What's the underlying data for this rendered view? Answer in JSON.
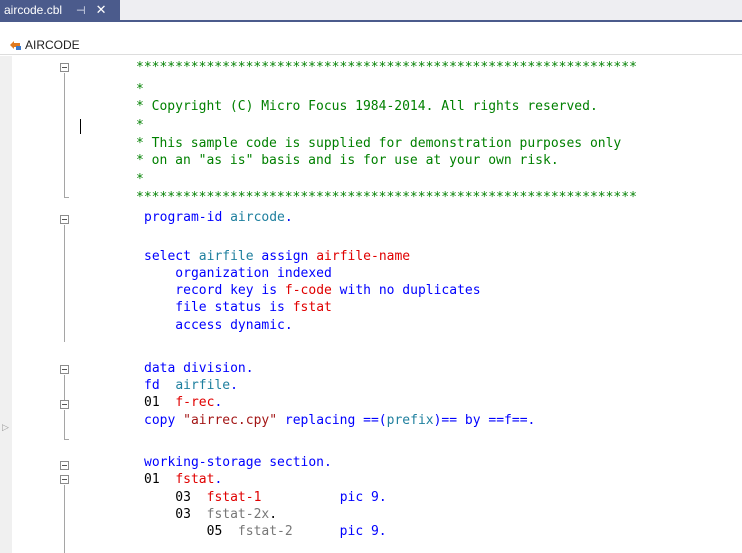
{
  "tab": {
    "title": "aircode.cbl",
    "pin_glyph": "⊣",
    "close_glyph": "✕"
  },
  "nav": {
    "program": "AIRCODE"
  },
  "colors": {
    "tab_active": "#4b5b8c",
    "comment": "#008000",
    "keyword": "#0000ff",
    "identifier": "#1e7f9e",
    "variable": "#e00000",
    "literal": "#a31515"
  },
  "code": {
    "line1": "****************************************************************",
    "line2": "*",
    "line3": "* Copyright (C) Micro Focus 1984-2014. All rights reserved.",
    "line4": "*",
    "line5": "* This sample code is supplied for demonstration purposes only",
    "line6": "* on an \"as is\" basis and is for use at your own risk.",
    "line7": "*",
    "line8": "****************************************************************",
    "prog_kw": "program-id ",
    "prog_name": "aircode",
    "prog_dot": ".",
    "sel_kw1": "select ",
    "sel_file": "airfile",
    "sel_kw2": " assign ",
    "sel_var": "airfile-name",
    "org": "    organization indexed",
    "rk_kw1": "    record key is ",
    "rk_var": "f-code",
    "rk_kw2": " with no duplicates",
    "fs_kw": "    file status is ",
    "fs_var": "fstat",
    "access": "    access dynamic.",
    "data_div": "data division.",
    "fd_kw": "fd  ",
    "fd_name": "airfile",
    "fd_dot": ".",
    "rec_lvl": "01  ",
    "rec_var": "f-rec",
    "rec_dot": ".",
    "copy_kw": "copy ",
    "copy_lit": "\"airrec.cpy\"",
    "copy_kw2": " replacing ==(",
    "copy_id": "prefix",
    "copy_kw3": ")== by ==f==.",
    "ws": "working-storage section.",
    "fstat_lvl": "01  ",
    "fstat_var": "fstat",
    "fstat_dot": ".",
    "f1_lvl": "    03  ",
    "f1_var": "fstat-1",
    "f1_pic": "          pic 9.",
    "f2x_lvl": "    03  ",
    "f2x_var": "fstat-2x",
    "f2x_dot": ".",
    "f2_lvl": "        05  ",
    "f2_var": "fstat-2",
    "f2_pic": "      pic 9."
  }
}
